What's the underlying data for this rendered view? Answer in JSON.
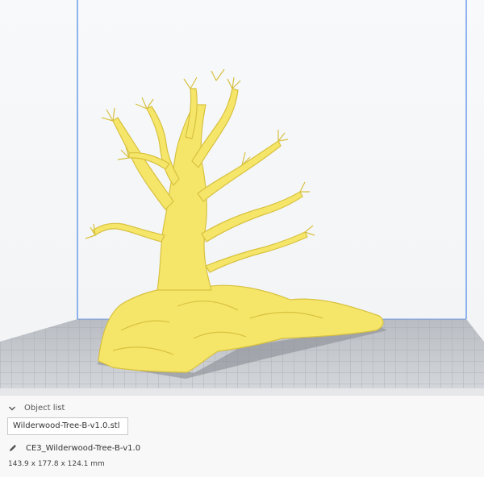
{
  "object_list": {
    "header_label": "Object list",
    "file_name": "Wilderwood-Tree-B-v1.0.stl"
  },
  "job": {
    "name": "CE3_Wilderwood-Tree-B-v1.0"
  },
  "model": {
    "dimensions": "143.9 x 177.8 x 124.1 mm"
  },
  "icons": {
    "collapse": "chevron-down-icon",
    "edit": "pencil-icon"
  },
  "colors": {
    "model": "#f5e66a",
    "model_shade": "#d8c13e",
    "build_volume_edge": "#4a86e8",
    "build_plate": "#c9ccd1",
    "grid_line": "#adb1b8"
  }
}
